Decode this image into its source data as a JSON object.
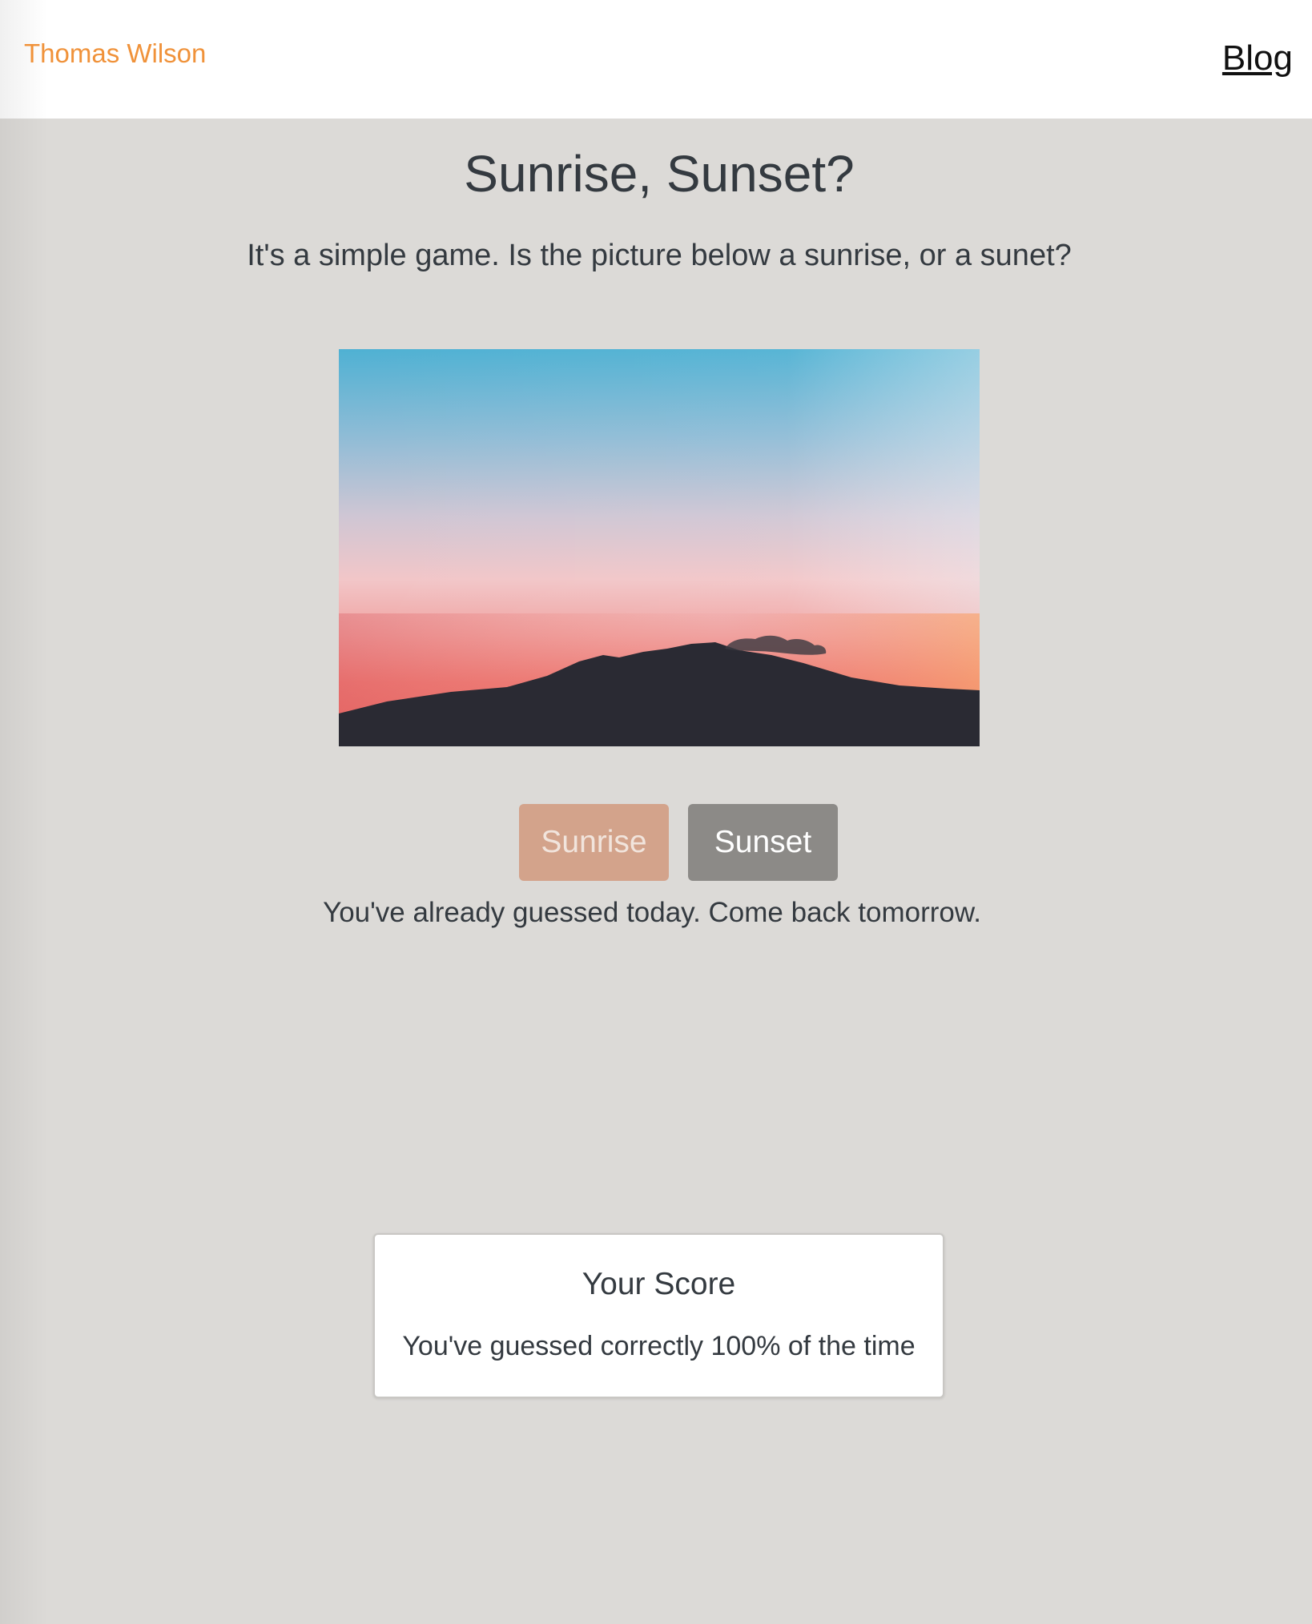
{
  "header": {
    "brand": "Thomas Wilson",
    "nav_blog": "Blog"
  },
  "main": {
    "title": "Sunrise, Sunset?",
    "subtitle": "It's a simple game. Is the picture below a sunrise, or a sunet?",
    "buttons": {
      "sunrise_label": "Sunrise",
      "sunset_label": "Sunset",
      "sunrise_disabled": true
    },
    "status": "You've already guessed today. Come back tomorrow."
  },
  "score": {
    "title": "Your Score",
    "text": "You've guessed correctly 100% of the time"
  },
  "colors": {
    "brand": "#f0923a",
    "background": "#dcdad7",
    "sunrise_button": "#d3a38b",
    "sunset_button": "#8c8a87"
  }
}
